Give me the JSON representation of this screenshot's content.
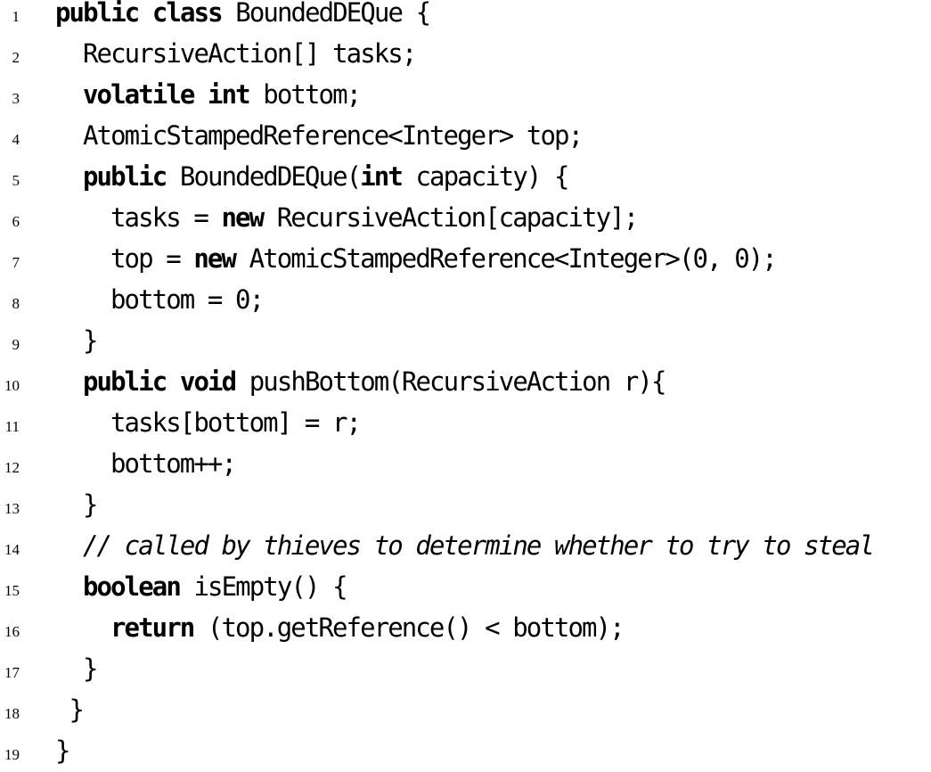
{
  "code_lines": [
    {
      "n": "1",
      "indent": 0,
      "segments": [
        {
          "t": "public",
          "s": "kw"
        },
        {
          "t": " "
        },
        {
          "t": "class",
          "s": "kw"
        },
        {
          "t": " BoundedDEQue {"
        }
      ]
    },
    {
      "n": "2",
      "indent": 1,
      "segments": [
        {
          "t": "RecursiveAction[] tasks;"
        }
      ]
    },
    {
      "n": "3",
      "indent": 1,
      "segments": [
        {
          "t": "volatile",
          "s": "kw"
        },
        {
          "t": " "
        },
        {
          "t": "int",
          "s": "kw"
        },
        {
          "t": " bottom;"
        }
      ]
    },
    {
      "n": "4",
      "indent": 1,
      "segments": [
        {
          "t": "AtomicStampedReference<Integer> top;"
        }
      ]
    },
    {
      "n": "5",
      "indent": 1,
      "segments": [
        {
          "t": "public",
          "s": "kw"
        },
        {
          "t": " BoundedDEQue("
        },
        {
          "t": "int",
          "s": "kw"
        },
        {
          "t": " capacity) {"
        }
      ]
    },
    {
      "n": "6",
      "indent": 2,
      "segments": [
        {
          "t": "tasks = "
        },
        {
          "t": "new",
          "s": "kw"
        },
        {
          "t": " RecursiveAction[capacity];"
        }
      ]
    },
    {
      "n": "7",
      "indent": 2,
      "segments": [
        {
          "t": "top = "
        },
        {
          "t": "new",
          "s": "kw"
        },
        {
          "t": " AtomicStampedReference<Integer>(0, 0);"
        }
      ]
    },
    {
      "n": "8",
      "indent": 2,
      "segments": [
        {
          "t": "bottom = 0;"
        }
      ]
    },
    {
      "n": "9",
      "indent": 1,
      "segments": [
        {
          "t": "}"
        }
      ]
    },
    {
      "n": "10",
      "indent": 1,
      "segments": [
        {
          "t": "public",
          "s": "kw"
        },
        {
          "t": " "
        },
        {
          "t": "void",
          "s": "kw"
        },
        {
          "t": " pushBottom(RecursiveAction r){"
        }
      ]
    },
    {
      "n": "11",
      "indent": 2,
      "segments": [
        {
          "t": "tasks[bottom] = r;"
        }
      ]
    },
    {
      "n": "12",
      "indent": 2,
      "segments": [
        {
          "t": "bottom++;"
        }
      ]
    },
    {
      "n": "13",
      "indent": 1,
      "segments": [
        {
          "t": "}"
        }
      ]
    },
    {
      "n": "14",
      "indent": 1,
      "segments": [
        {
          "t": "// called by thieves to determine whether to try to steal",
          "s": "cm"
        }
      ]
    },
    {
      "n": "15",
      "indent": 1,
      "segments": [
        {
          "t": "boolean",
          "s": "kw"
        },
        {
          "t": " isEmpty() {"
        }
      ]
    },
    {
      "n": "16",
      "indent": 2,
      "segments": [
        {
          "t": "return",
          "s": "kw"
        },
        {
          "t": " (top.getReference() < bottom);"
        }
      ]
    },
    {
      "n": "17",
      "indent": 1,
      "segments": [
        {
          "t": "}"
        }
      ]
    },
    {
      "n": "18",
      "indent": 0.5,
      "segments": [
        {
          "t": "}"
        }
      ]
    },
    {
      "n": "19",
      "indent": 0,
      "segments": [
        {
          "t": "}"
        }
      ]
    }
  ]
}
